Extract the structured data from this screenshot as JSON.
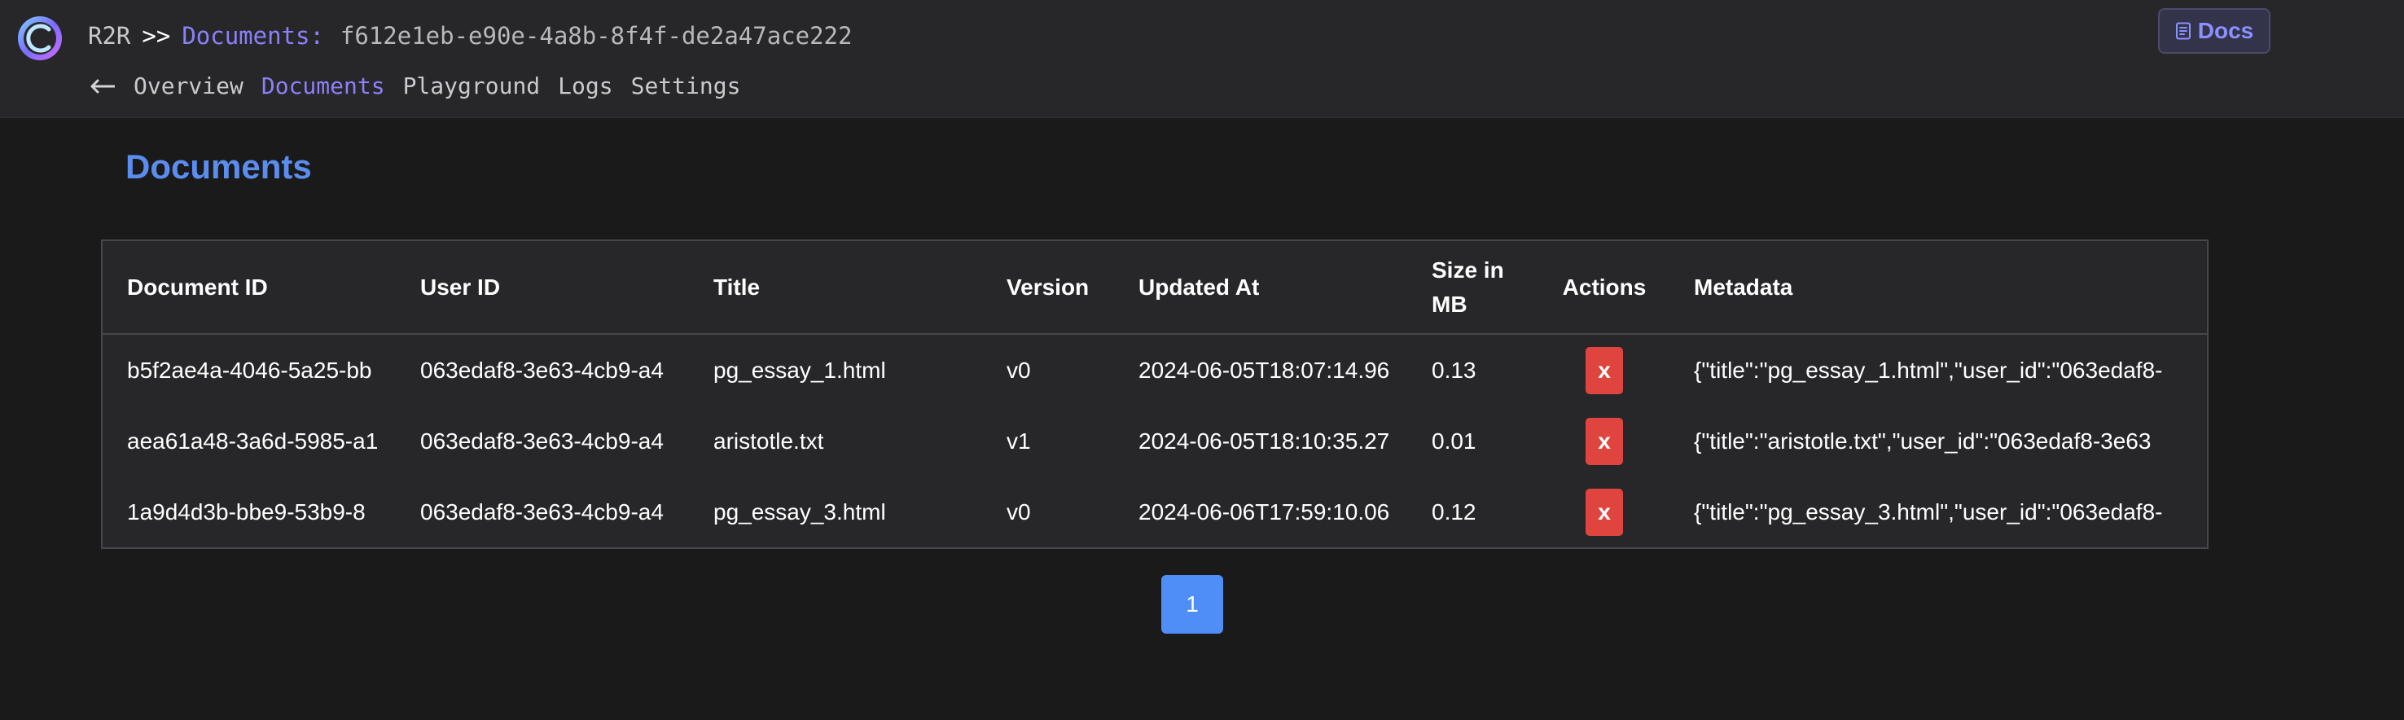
{
  "header": {
    "breadcrumb": {
      "app": "R2R",
      "separator": ">>",
      "section": "Documents:",
      "document_id": "f612e1eb-e90e-4a8b-8f4f-de2a47ace222"
    },
    "nav": {
      "items": [
        "Overview",
        "Documents",
        "Playground",
        "Logs",
        "Settings"
      ],
      "active": "Documents"
    },
    "docs_button_label": "Docs"
  },
  "main": {
    "title": "Documents",
    "table": {
      "columns": [
        "Document ID",
        "User ID",
        "Title",
        "Version",
        "Updated At",
        "Size in MB",
        "Actions",
        "Metadata"
      ],
      "rows": [
        {
          "document_id": "b5f2ae4a-4046-5a25-bb",
          "user_id": "063edaf8-3e63-4cb9-a4",
          "title": "pg_essay_1.html",
          "version": "v0",
          "updated_at": "2024-06-05T18:07:14.96",
          "size_mb": "0.13",
          "action_label": "x",
          "metadata": "{\"title\":\"pg_essay_1.html\",\"user_id\":\"063edaf8-"
        },
        {
          "document_id": "aea61a48-3a6d-5985-a1",
          "user_id": "063edaf8-3e63-4cb9-a4",
          "title": "aristotle.txt",
          "version": "v1",
          "updated_at": "2024-06-05T18:10:35.27",
          "size_mb": "0.01",
          "action_label": "x",
          "metadata": "{\"title\":\"aristotle.txt\",\"user_id\":\"063edaf8-3e63"
        },
        {
          "document_id": "1a9d4d3b-bbe9-53b9-8",
          "user_id": "063edaf8-3e63-4cb9-a4",
          "title": "pg_essay_3.html",
          "version": "v0",
          "updated_at": "2024-06-06T17:59:10.06",
          "size_mb": "0.12",
          "action_label": "x",
          "metadata": "{\"title\":\"pg_essay_3.html\",\"user_id\":\"063edaf8-"
        }
      ]
    },
    "pagination": {
      "current_page": "1"
    }
  },
  "colors": {
    "accent": "#8b80f9",
    "title_blue": "#5b8def",
    "delete_red": "#e0443e",
    "page_button": "#4f8ef7"
  },
  "icons": {
    "logo": "r2r-logo-icon",
    "back": "arrow-left-icon",
    "docs": "document-icon"
  }
}
